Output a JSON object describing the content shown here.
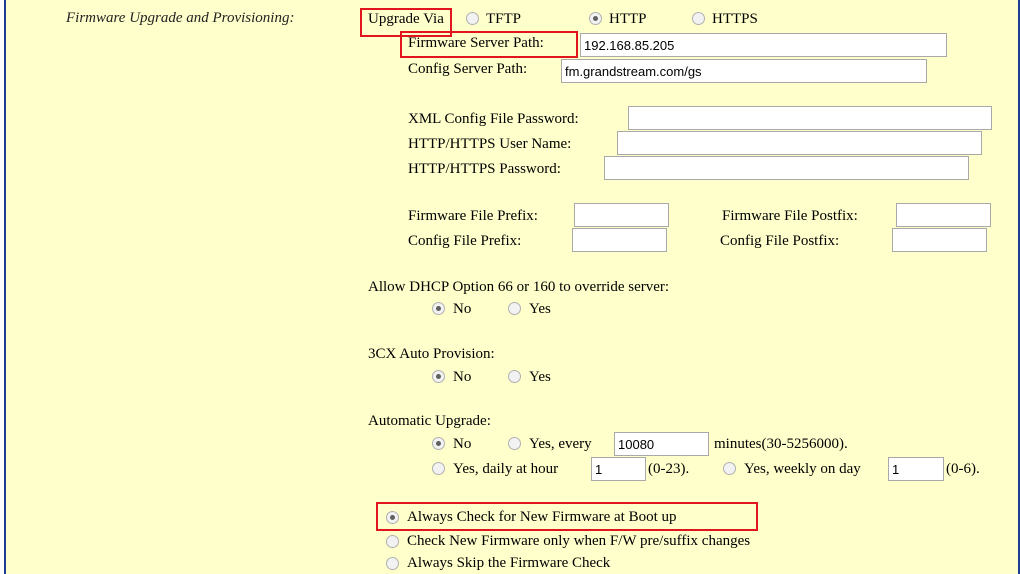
{
  "section_label": "Firmware Upgrade and Provisioning:",
  "upgrade_via": {
    "label": "Upgrade Via",
    "options": [
      "TFTP",
      "HTTP",
      "HTTPS"
    ],
    "selected": "HTTP"
  },
  "firmware_server_path": {
    "label": "Firmware Server Path:",
    "value": "192.168.85.205"
  },
  "config_server_path": {
    "label": "Config Server Path:",
    "value": "fm.grandstream.com/gs"
  },
  "xml_config_password": {
    "label": "XML Config File Password:",
    "value": ""
  },
  "http_user_name": {
    "label": "HTTP/HTTPS User Name:",
    "value": ""
  },
  "http_password": {
    "label": "HTTP/HTTPS Password:",
    "value": ""
  },
  "firmware_file_prefix": {
    "label": "Firmware File Prefix:",
    "value": ""
  },
  "firmware_file_postfix": {
    "label": "Firmware File Postfix:",
    "value": ""
  },
  "config_file_prefix": {
    "label": "Config File Prefix:",
    "value": ""
  },
  "config_file_postfix": {
    "label": "Config File Postfix:",
    "value": ""
  },
  "dhcp_override": {
    "label": "Allow DHCP Option 66 or 160 to override server:",
    "options": [
      "No",
      "Yes"
    ],
    "selected": "No"
  },
  "auto_provision_3cx": {
    "label": "3CX Auto Provision:",
    "options": [
      "No",
      "Yes"
    ],
    "selected": "No"
  },
  "automatic_upgrade": {
    "label": "Automatic Upgrade:",
    "no_label": "No",
    "every_label": "Yes, every",
    "every_value": "10080",
    "every_suffix": "minutes(30-5256000).",
    "daily_label": "Yes, daily at hour",
    "daily_value": "1",
    "daily_suffix": "(0-23).",
    "weekly_label": "Yes, weekly on day",
    "weekly_value": "1",
    "weekly_suffix": "(0-6).",
    "selected": "No"
  },
  "firmware_check": {
    "options": [
      "Always Check for New Firmware at Boot up",
      "Check New Firmware only when F/W pre/suffix changes",
      "Always Skip the Firmware Check"
    ],
    "selected": "Always Check for New Firmware at Boot up"
  },
  "colors": {
    "background": "#ffffcc",
    "frame_border": "#1c3f94",
    "highlight": "#e0151e"
  }
}
